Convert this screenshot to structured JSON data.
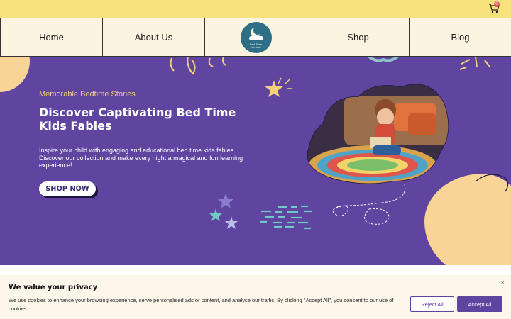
{
  "cart": {
    "badge_count": "0"
  },
  "nav": {
    "items": [
      "Home",
      "About Us",
      "Shop",
      "Blog"
    ],
    "logo_text": "Bed Time",
    "logo_subtext": "kids fables"
  },
  "hero": {
    "eyebrow": "Memorable Bedtime Stories",
    "title": "Discover Captivating Bed Time Kids Fables",
    "description": "Inspire your child with engaging and educational bed time kids fables. Discover our collection and make every night a magical and fun learning experience!",
    "cta_label": "SHOP NOW"
  },
  "cookie": {
    "title": "We value your privacy",
    "text": "We use cookies to enhance your browsing experience, serve personalised ads or content, and analyse our traffic. By clicking \"Accept All\", you consent to our use of cookies.",
    "reject_label": "Reject All",
    "accept_label": "Accept All",
    "close_glyph": "×"
  },
  "colors": {
    "top_bar": "#f7e27e",
    "nav_bg": "#fdf3e1",
    "hero_bg": "#5f44a0",
    "accent_yellow": "#f5cf7c",
    "blob": "#f8d597",
    "cookie_bg": "#fdf6ea"
  },
  "icons": [
    "cart-icon",
    "star-icon",
    "moon-logo-icon",
    "close-icon"
  ]
}
